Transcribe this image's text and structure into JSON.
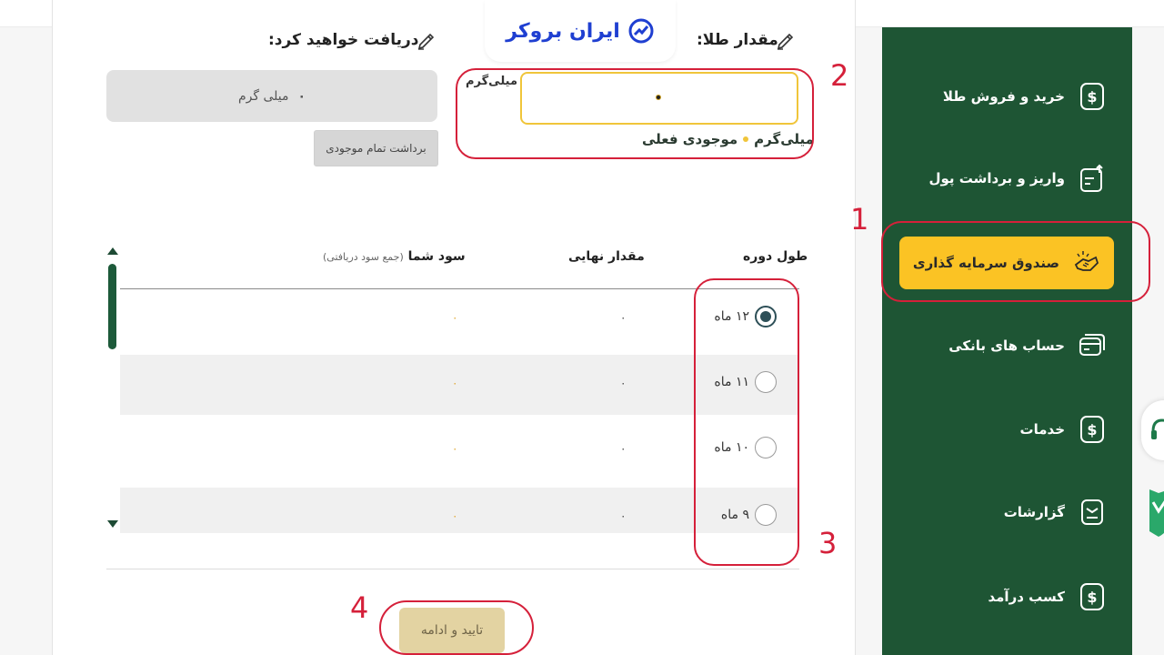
{
  "logo": {
    "text": "ایران بروکر"
  },
  "form": {
    "gold_amount_label": "مقدار طلا:",
    "receive_label": "دریافت خواهید کرد:",
    "receive_value": "۰",
    "receive_unit": "میلی گرم",
    "withdraw_all_label": "برداشت تمام موجودی",
    "input_unit": "میلی‌گرم",
    "balance_label": "موجودی فعلی",
    "balance_unit": "میلی‌گرم"
  },
  "table": {
    "headers": {
      "duration": "طول دوره",
      "final": "مقدار نهایی",
      "profit": "سود شما",
      "profit_note": "(جمع سود دریافتی)"
    },
    "rows": [
      {
        "duration": "۱۲ ماه",
        "final": "۰",
        "profit": "۰",
        "selected": true
      },
      {
        "duration": "۱۱ ماه",
        "final": "۰",
        "profit": "۰",
        "selected": false
      },
      {
        "duration": "۱۰ ماه",
        "final": "۰",
        "profit": "۰",
        "selected": false
      },
      {
        "duration": "۹ ماه",
        "final": "۰",
        "profit": "۰",
        "selected": false
      }
    ]
  },
  "confirm_label": "تایید و ادامه",
  "sidebar": {
    "items": [
      {
        "label": "خرید و فروش طلا",
        "icon": "dollar-icon"
      },
      {
        "label": "واریز و برداشت پول",
        "icon": "transfer-icon"
      },
      {
        "label": "صندوق سرمایه گذاری",
        "icon": "handshake-icon",
        "active": true
      },
      {
        "label": "حساب های بانکی",
        "icon": "card-icon"
      },
      {
        "label": "خدمات",
        "icon": "dollar-icon"
      },
      {
        "label": "گزارشات",
        "icon": "report-icon"
      },
      {
        "label": "کسب درآمد",
        "icon": "dollar-icon"
      }
    ]
  },
  "annotations": [
    "1",
    "2",
    "3",
    "4"
  ],
  "colors": {
    "sidebar_bg": "#1e5534",
    "active_item": "#fbc324",
    "annotation": "#d5203a",
    "input_border": "#f0c53a",
    "confirm_bg": "#e3d3a2"
  }
}
